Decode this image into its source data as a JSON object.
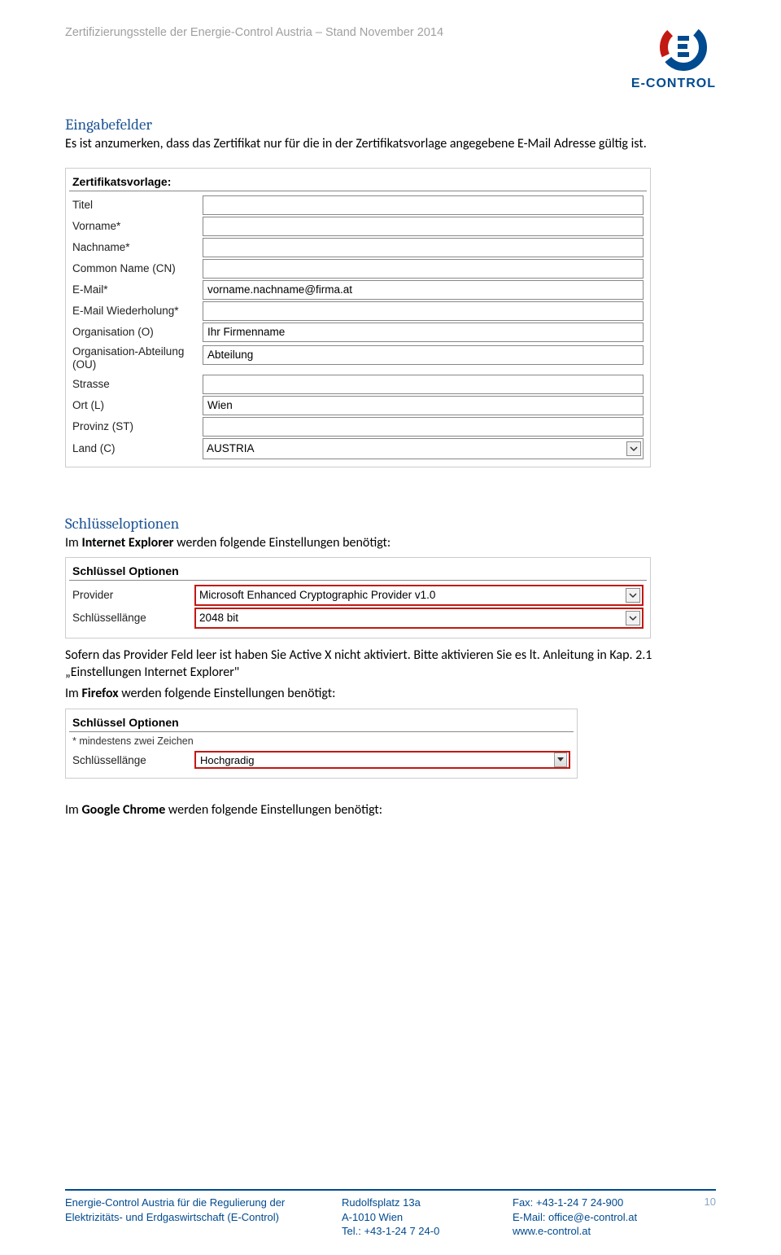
{
  "header": {
    "line": "Zertifizierungsstelle der Energie-Control Austria – Stand November 2014",
    "logo_text": "E-CONTROL"
  },
  "section1": {
    "heading": "Eingabefelder",
    "para": "Es ist anzumerken, dass das  Zertifikat nur für die in der Zertifikatsvorlage angegebene E-Mail Adresse gültig ist."
  },
  "form1": {
    "title": "Zertifikatsvorlage:",
    "rows": [
      {
        "label": "Titel",
        "value": ""
      },
      {
        "label": "Vorname*",
        "value": ""
      },
      {
        "label": "Nachname*",
        "value": ""
      },
      {
        "label": "Common Name (CN)",
        "value": ""
      },
      {
        "label": "E-Mail*",
        "value": "vorname.nachname@firma.at"
      },
      {
        "label": "E-Mail Wiederholung*",
        "value": ""
      },
      {
        "label": "Organisation (O)",
        "value": "Ihr Firmenname"
      },
      {
        "label": "Organisation-Abteilung (OU)",
        "value": "Abteilung",
        "tall": true
      },
      {
        "label": "Strasse",
        "value": ""
      },
      {
        "label": "Ort (L)",
        "value": "Wien"
      },
      {
        "label": "Provinz (ST)",
        "value": ""
      }
    ],
    "select_label": "Land (C)",
    "select_value": "AUSTRIA"
  },
  "section2": {
    "heading": "Schlüsseloptionen",
    "para1_before": "Im ",
    "para1_bold": "Internet Explorer",
    "para1_after": " werden folgende Einstellungen benötigt:"
  },
  "form2": {
    "title": "Schlüssel Optionen",
    "provider_label": "Provider",
    "provider_value": "Microsoft Enhanced Cryptographic Provider v1.0",
    "keylen_label": "Schlüssellänge",
    "keylen_value": "2048 bit"
  },
  "section2b": {
    "para": "Sofern das Provider Feld leer ist haben Sie Active X nicht aktiviert. Bitte aktivieren Sie es lt. Anleitung in Kap. 2.1 „Einstellungen Internet Explorer\"",
    "para2_before": "Im ",
    "para2_bold": "Firefox",
    "para2_after": " werden folgende Einstellungen benötigt:"
  },
  "form3": {
    "title": "Schlüssel Optionen",
    "note": "* mindestens zwei Zeichen",
    "keylen_label": "Schlüssellänge",
    "keylen_value": "Hochgradig"
  },
  "section2c": {
    "para_before": "Im ",
    "para_bold": "Google Chrome",
    "para_after": " werden folgende Einstellungen benötigt:"
  },
  "footer": {
    "col1_l1": "Energie-Control Austria für die Regulierung der",
    "col1_l2": "Elektrizitäts- und Erdgaswirtschaft (E-Control)",
    "col2_l1": "Rudolfsplatz 13a",
    "col2_l2": "A-1010 Wien",
    "col2_l3": "Tel.: +43-1-24 7 24-0",
    "col3_l1": "Fax: +43-1-24 7 24-900",
    "col3_l2": "E-Mail: office@e-control.at",
    "col3_l3": "www.e-control.at",
    "page": "10"
  }
}
